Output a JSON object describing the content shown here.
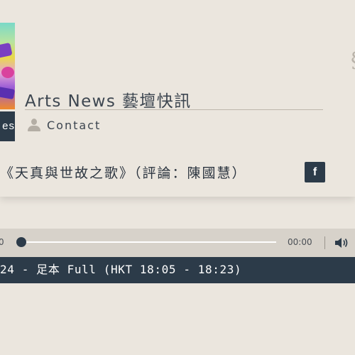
{
  "header": {
    "program_title": "Arts News 藝壇快訊",
    "nav_tab_label": "es",
    "contact_label": "Contact"
  },
  "episode": {
    "title": "《天真與世故之歌》（評論：陳國慧）",
    "share_label": "f"
  },
  "player": {
    "current_time": "0",
    "total_time": "00:00",
    "progress_fraction": 0
  },
  "now_playing": {
    "text": "24 - 足本 Full (HKT 18:05 - 18:23)"
  },
  "colors": {
    "dark_navy": "#2c3b49",
    "background": "#ebe6de"
  },
  "icons": {
    "contact": "person-icon",
    "share": "facebook-icon",
    "volume": "volume-icon"
  }
}
